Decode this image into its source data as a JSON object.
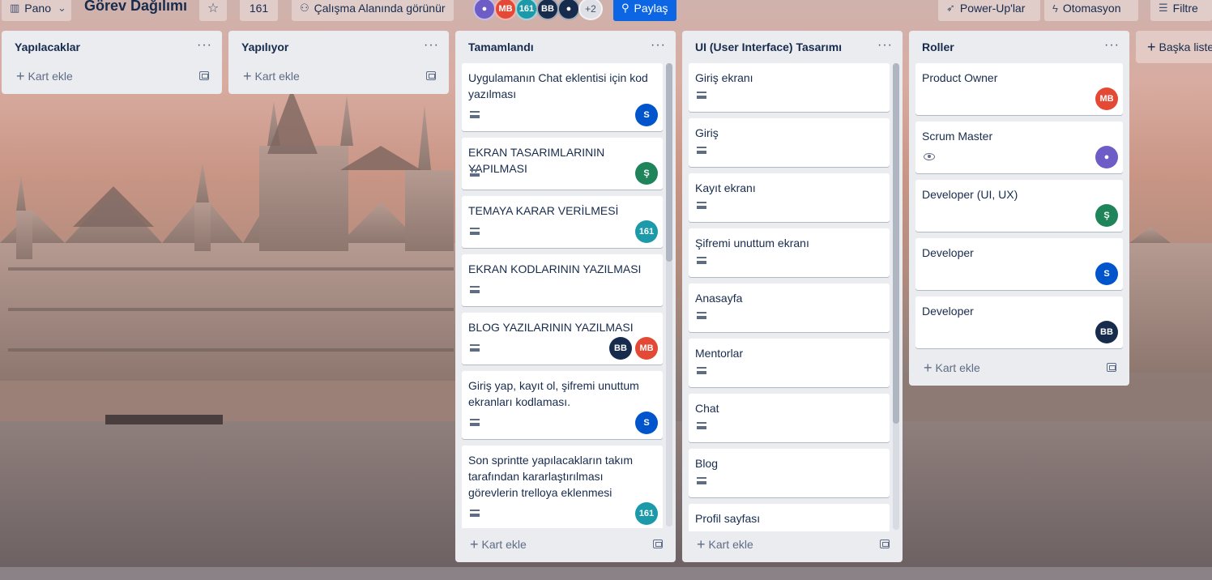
{
  "colors": {
    "accent": "#0c66e4",
    "list_bg": "#ebecf0",
    "mb": "#e34935",
    "s": "#0055cc",
    "sh": "#1f845a",
    "n161": "#1d9aaa",
    "bb": "#172b4d",
    "purple": "#6e5dc6"
  },
  "header": {
    "board_switch": {
      "icon": "board-icon",
      "label": "Pano"
    },
    "title": "Görev Dağılımı",
    "star_icon": "star-icon",
    "count_button": "161",
    "visibility": {
      "icon": "people-icon",
      "label": "Çalışma Alanında görünür"
    },
    "avatars": [
      {
        "initials": "",
        "color": "#6e5dc6",
        "icon": "user-icon"
      },
      {
        "initials": "MB",
        "color": "#e34935"
      },
      {
        "initials": "161",
        "color": "#1d9aaa"
      },
      {
        "initials": "BB",
        "color": "#172b4d"
      },
      {
        "initials": "",
        "color": "#172b4d",
        "icon": "user-icon"
      }
    ],
    "avatars_more": "+2",
    "share": {
      "icon": "add-user-icon",
      "label": "Paylaş"
    },
    "powerups": {
      "icon": "rocket-icon",
      "label": "Power-Up'lar"
    },
    "automation": {
      "icon": "lightning-icon",
      "label": "Otomasyon"
    },
    "filter": {
      "icon": "filter-icon",
      "label": "Filtre"
    }
  },
  "lists": [
    {
      "title": "Yapılacaklar",
      "menu": "···",
      "add_card": "Kart ekle",
      "cards": []
    },
    {
      "title": "Yapılıyor",
      "menu": "···",
      "add_card": "Kart ekle",
      "cards": []
    },
    {
      "title": "Tamamlandı",
      "menu": "···",
      "add_card": "Kart ekle",
      "cards": [
        {
          "title": "Uygulamanın Chat eklentisi için kod yazılması",
          "desc": true,
          "members": [
            {
              "initials": "S",
              "color": "#0055cc"
            }
          ]
        },
        {
          "title": "EKRAN TASARIMLARININ YAPILMASI",
          "desc": true,
          "members": [
            {
              "initials": "Ş",
              "color": "#1f845a"
            }
          ]
        },
        {
          "title": "TEMAYA KARAR VERİLMESİ",
          "desc": true,
          "members": [
            {
              "initials": "161",
              "color": "#1d9aaa"
            }
          ]
        },
        {
          "title": "EKRAN KODLARININ YAZILMASI",
          "desc": true,
          "members": []
        },
        {
          "title": "BLOG YAZILARININ YAZILMASI",
          "desc": true,
          "members": [
            {
              "initials": "BB",
              "color": "#172b4d"
            },
            {
              "initials": "MB",
              "color": "#e34935"
            }
          ]
        },
        {
          "title": "Giriş yap, kayıt ol, şifremi unuttum ekranları kodlaması.",
          "desc": true,
          "members": [
            {
              "initials": "S",
              "color": "#0055cc"
            }
          ]
        },
        {
          "title": "Son sprintte yapılacakların takım tarafından kararlaştırılması görevlerin trelloya eklenmesi",
          "desc": true,
          "members": [
            {
              "initials": "161",
              "color": "#1d9aaa"
            }
          ]
        }
      ]
    },
    {
      "title": "UI (User Interface) Tasarımı",
      "menu": "···",
      "add_card": "Kart ekle",
      "cards": [
        {
          "title": "Giriş ekranı",
          "desc": true,
          "members": []
        },
        {
          "title": "Giriş",
          "desc": true,
          "members": []
        },
        {
          "title": "Kayıt ekranı",
          "desc": true,
          "members": []
        },
        {
          "title": "Şifremi unuttum ekranı",
          "desc": true,
          "members": []
        },
        {
          "title": "Anasayfa",
          "desc": true,
          "members": []
        },
        {
          "title": "Mentorlar",
          "desc": true,
          "members": []
        },
        {
          "title": "Chat",
          "desc": true,
          "members": []
        },
        {
          "title": "Blog",
          "desc": true,
          "members": []
        },
        {
          "title": "Profil sayfası",
          "desc": false,
          "members": []
        }
      ]
    },
    {
      "title": "Roller",
      "menu": "···",
      "add_card": "Kart ekle",
      "cards": [
        {
          "title": "Product Owner",
          "desc": false,
          "members": [
            {
              "initials": "MB",
              "color": "#e34935"
            }
          ]
        },
        {
          "title": "Scrum Master",
          "watch": true,
          "members": [
            {
              "initials": "",
              "color": "#6e5dc6",
              "icon": "user-icon"
            }
          ]
        },
        {
          "title": "Developer (UI, UX)",
          "desc": false,
          "members": [
            {
              "initials": "Ş",
              "color": "#1f845a"
            }
          ]
        },
        {
          "title": "Developer",
          "desc": false,
          "members": [
            {
              "initials": "S",
              "color": "#0055cc"
            }
          ]
        },
        {
          "title": "Developer",
          "desc": false,
          "members": [
            {
              "initials": "BB",
              "color": "#172b4d"
            }
          ]
        }
      ]
    }
  ],
  "add_list": "Başka liste"
}
